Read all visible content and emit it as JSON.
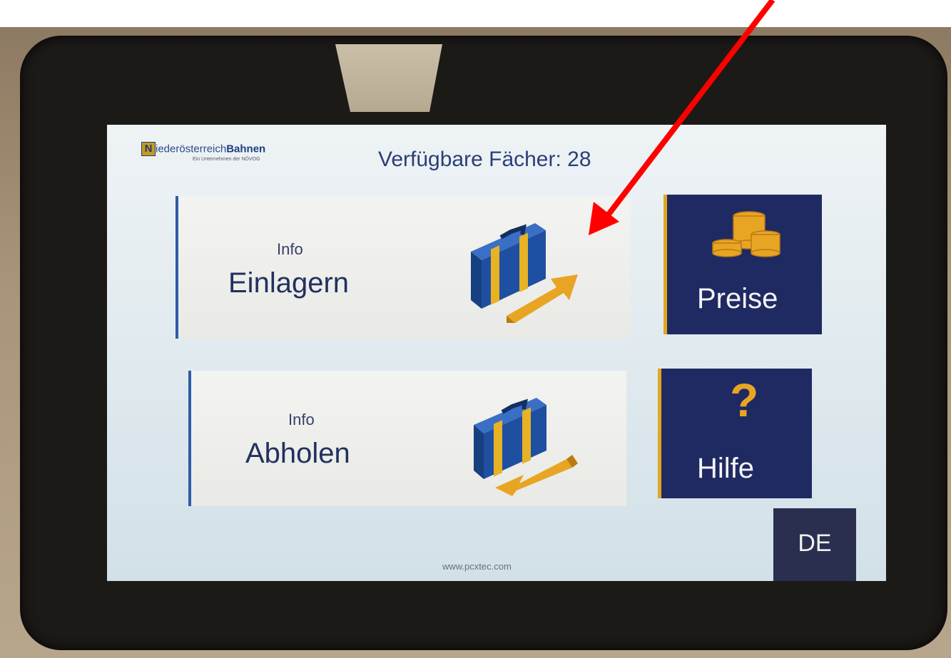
{
  "logo": {
    "mark": "N",
    "name_plain": "iederösterreich",
    "name_bold": "Bahnen",
    "subtitle": "Ein Unternehmen der NÖVOG"
  },
  "header": {
    "title": "Verfügbare Fächer: 28"
  },
  "tiles": {
    "store": {
      "info": "Info",
      "label": "Einlagern"
    },
    "pickup": {
      "info": "Info",
      "label": "Abholen"
    }
  },
  "side_buttons": {
    "prices": {
      "label": "Preise"
    },
    "help": {
      "label": "Hilfe",
      "icon": "?"
    }
  },
  "language": {
    "label": "DE"
  },
  "footer": {
    "url": "www.pcxtec.com"
  },
  "colors": {
    "accent_blue": "#1f2a63",
    "accent_gold": "#e1a721",
    "annotation_arrow": "#ff0000"
  }
}
